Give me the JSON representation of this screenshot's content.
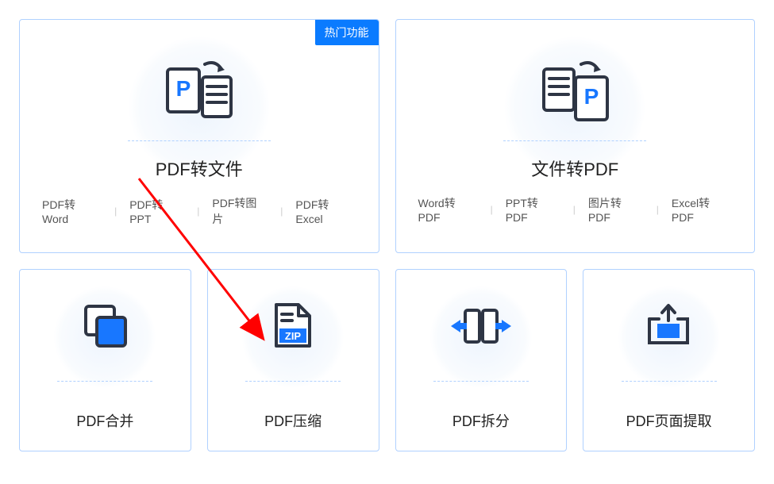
{
  "cards": {
    "pdfToFile": {
      "badge": "热门功能",
      "title": "PDF转文件",
      "subs": [
        "PDF转Word",
        "PDF转PPT",
        "PDF转图片",
        "PDF转Excel"
      ]
    },
    "fileToPdf": {
      "title": "文件转PDF",
      "subs": [
        "Word转PDF",
        "PPT转PDF",
        "图片转PDF",
        "Excel转PDF"
      ]
    },
    "merge": {
      "title": "PDF合并"
    },
    "compress": {
      "title": "PDF压缩"
    },
    "split": {
      "title": "PDF拆分"
    },
    "extract": {
      "title": "PDF页面提取"
    }
  }
}
